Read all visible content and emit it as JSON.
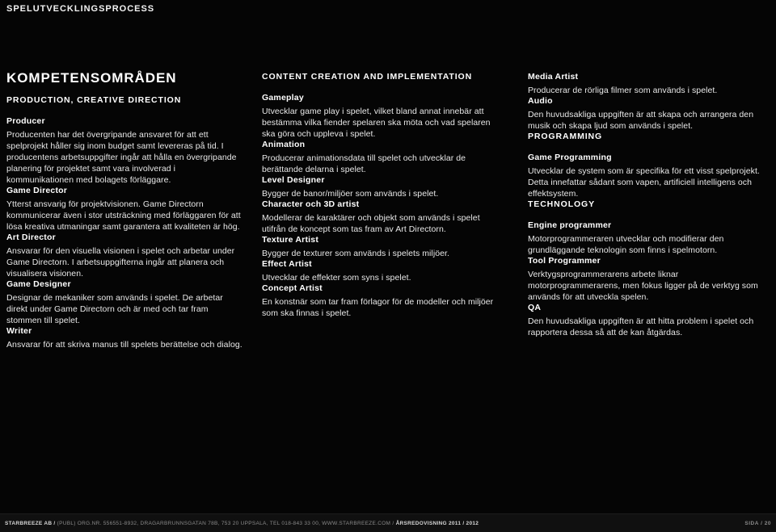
{
  "header": {
    "running_title": "SPELUTVECKLINGSPROCESS"
  },
  "section": {
    "title": "KOMPETENSOMRÅDEN"
  },
  "columns": {
    "col1": {
      "category": "PRODUCTION, CREATIVE DIRECTION",
      "entries": [
        {
          "role": "Producer",
          "text": "Producenten har det övergripande ansvaret för att ett spelprojekt håller sig inom budget samt levereras på tid. I producentens arbetsuppgifter ingår att hålla en övergripande planering för projektet samt vara involverad i kommunikationen med bolagets förläggare."
        },
        {
          "role": "Game Director",
          "text": "Ytterst ansvarig för projektvisionen. Game Directorn kommunicerar även i stor utsträckning med förläggaren för att lösa kreativa utmaningar samt garantera att kvaliteten är hög."
        },
        {
          "role": "Art Director",
          "text": "Ansvarar för den visuella visionen i spelet och arbetar under Game Directorn. I arbetsuppgifterna ingår att planera och visualisera visionen."
        },
        {
          "role": "Game Designer",
          "text": "Designar de mekaniker som används i spelet. De arbetar direkt under Game Directorn och är med och tar fram stommen till spelet."
        },
        {
          "role": "Writer",
          "text": "Ansvarar för att skriva manus till spelets berättelse och dialog."
        }
      ]
    },
    "col2": {
      "category": "CONTENT CREATION AND IMPLEMENTATION",
      "entries": [
        {
          "role": "Gameplay",
          "text": "Utvecklar game play i spelet, vilket bland annat innebär att bestämma vilka fiender spelaren ska möta och vad spelaren ska göra och uppleva i spelet."
        },
        {
          "role": "Animation",
          "text": "Producerar animationsdata till spelet och utvecklar de berättande delarna i spelet."
        },
        {
          "role": "Level Designer",
          "text": "Bygger de banor/miljöer som används i spelet."
        },
        {
          "role": "Character och 3D artist",
          "text": "Modellerar de karaktärer och objekt som används i spelet utifrån de koncept som tas fram av Art Directorn."
        },
        {
          "role": "Texture Artist",
          "text": "Bygger de texturer som används i spelets miljöer."
        },
        {
          "role": "Effect Artist",
          "text": "Utvecklar de effekter som syns i spelet."
        },
        {
          "role": "Concept Artist",
          "text": "En konstnär som tar fram förlagor för de modeller och miljöer som ska finnas i spelet."
        }
      ]
    },
    "col3": {
      "entries_top": [
        {
          "role": "Media Artist",
          "text": "Producerar de rörliga filmer som används i spelet."
        },
        {
          "role": "Audio",
          "text": "Den huvudsakliga uppgiften är att skapa och arrangera den musik och skapa ljud som används i spelet."
        }
      ],
      "category_programming": "PROGRAMMING",
      "entries_programming": [
        {
          "role": "Game Programming",
          "text": "Utvecklar de system som är specifika för ett visst spelprojekt. Detta innefattar sådant som vapen, artificiell intelligens och effektsystem."
        }
      ],
      "category_technology": "TECHNOLOGY",
      "entries_technology": [
        {
          "role": "Engine programmer",
          "text": "Motorprogrammeraren utvecklar och modifierar den grundläggande teknologin som finns i spelmotorn."
        },
        {
          "role": "Tool Programmer",
          "text": "Verktygsprogrammerarens arbete liknar motorprogrammerarens, men fokus ligger på de verktyg som används för att utveckla spelen."
        },
        {
          "role": "QA",
          "text": "Den huvudsakliga uppgiften är att hitta problem i spelet och rapportera dessa så att de kan åtgärdas."
        }
      ]
    }
  },
  "footer": {
    "company": "STARBREEZE AB /",
    "details": "(PUBL) ORG.NR. 556551-8932, DRAGARBRUNNSGATAN 78B, 753 20 UPPSALA, TEL 018-843 33 00, WWW.STARBREEZE.COM /",
    "report": "ÅRSREDOVISNING 2011 / 2012",
    "page": "SIDA / 20"
  }
}
